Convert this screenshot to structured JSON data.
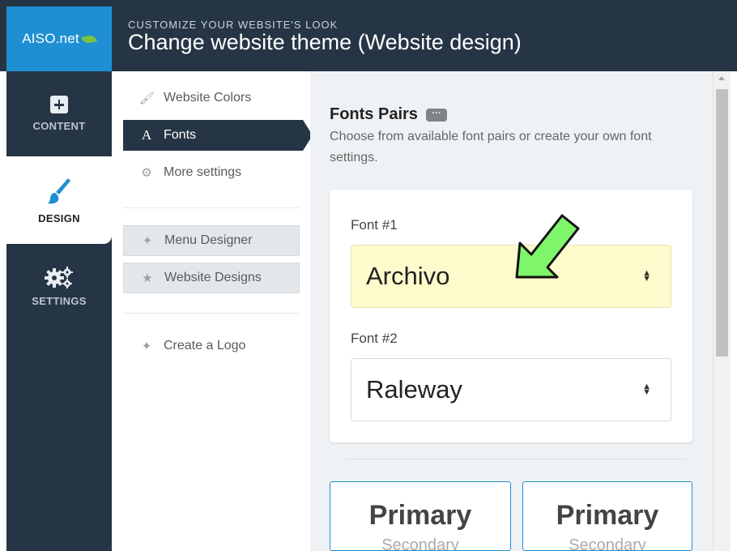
{
  "header": {
    "logo_text": "AISO.net",
    "subtitle": "CUSTOMIZE YOUR WEBSITE'S LOOK",
    "title": "Change website theme (Website design)"
  },
  "leftnav": {
    "items": [
      {
        "label": "CONTENT",
        "icon": "plus-square-icon"
      },
      {
        "label": "DESIGN",
        "icon": "paintbrush-icon"
      },
      {
        "label": "SETTINGS",
        "icon": "gears-icon"
      }
    ]
  },
  "subnav": {
    "website_colors": "Website Colors",
    "fonts": "Fonts",
    "more_settings": "More settings",
    "menu_designer": "Menu Designer",
    "website_designs": "Website Designs",
    "create_logo": "Create a Logo"
  },
  "main": {
    "section_title": "Fonts Pairs",
    "more_label": "···",
    "description": "Choose from available font pairs or create your own font settings.",
    "font1_label": "Font #1",
    "font1_value": "Archivo",
    "font2_label": "Font #2",
    "font2_value": "Raleway",
    "pairs": [
      {
        "primary": "Primary",
        "secondary": "Secondary"
      },
      {
        "primary": "Primary",
        "secondary": "Secondary"
      }
    ]
  },
  "colors": {
    "header_bg": "#263545",
    "logo_bg": "#1f8fd3",
    "accent_blue": "#1f8fd3",
    "font1_highlight": "#fdfbcc",
    "annotation_arrow": "#7ef56a"
  }
}
